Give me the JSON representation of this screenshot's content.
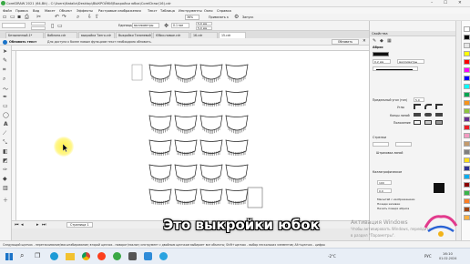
{
  "window": {
    "title": "CorelDRAW 2021 (64-Bit) - C:\\Users\\Natalia\\Desktop\\ВЫКРОЙКИ\\Выкройки юбок\\CorelDraw(16).cdr",
    "minimize": "–",
    "maximize": "☐",
    "close": "✕"
  },
  "menu": [
    "Файл",
    "Правка",
    "Вид",
    "Макет",
    "Объект",
    "Эффекты",
    "Растровые изображения",
    "Текст",
    "Таблица",
    "Инструменты",
    "Окно",
    "Справка"
  ],
  "toolbar": {
    "zoom": "36%",
    "snap_label": "Привязать к",
    "launch_label": "Запуск",
    "units_label": "Единицы:",
    "units_value": "миллиметры",
    "nudge_value": "0.1 мм",
    "dup_x": "5.0 мм",
    "dup_y": "5.0 мм"
  },
  "document_tabs": [
    {
      "label": "Безымянный-1*",
      "active": false
    },
    {
      "label": "Ваблона.cdr",
      "active": false
    },
    {
      "label": "выкройка Танго.cdr",
      "active": false
    },
    {
      "label": "Выкройки Таниневой",
      "active": false
    },
    {
      "label": "Юбки-новые.cdr",
      "active": false
    },
    {
      "label": "16.cdr",
      "active": false
    },
    {
      "label": "15.cdr",
      "active": true
    }
  ],
  "notice": {
    "title": "Обновить текст",
    "message": "Для доступа к более новым функциям текст необходимо обновить.",
    "button": "Обновить"
  },
  "page_tab": "Страница 1",
  "status_text": "Следующий щелчок - перетаскивание/масштабирование; второй щелчок - поворот/наклон; инструмент с двойным щелчком выбирает все объекты; Shift+щелчок - выбор нескольких элементов; Alt+щелчок - цифры",
  "properties": {
    "panel_title": "Свойства",
    "section_outline": "Абрис",
    "width_value": "0.2 мм",
    "units": "миллиметры",
    "miter_label": "Предельный угол (тон)",
    "miter_value": "5.0",
    "corners_label": "Углы",
    "line_caps_label": "Концы линий",
    "position_label": "Положение",
    "arrows_label": "Стрелки",
    "stroke_label": "Штриховка линий",
    "calligraphy_label": "Каллиграфическое",
    "cal_width": "100",
    "cal_angle": "0.0",
    "scale_label": "Масштаб с изображением",
    "behind_fill_label": "Позади заливки",
    "overprint_label": "Печать поверх абриса"
  },
  "subtitle": "Это выкройки юбок",
  "watermark": {
    "line1": "Активация Windows",
    "line2": "Чтобы активировать Windows, перейдите",
    "line3": "в раздел \"Параметры\"."
  },
  "taskbar": {
    "lang": "РУС",
    "time": "16:10",
    "date": "01.02.2024",
    "temp": "-2°C"
  },
  "colors": {
    "accent": "#1a73c8",
    "subtitle": "#ffffff",
    "cursor_highlight": "#fff03c"
  }
}
